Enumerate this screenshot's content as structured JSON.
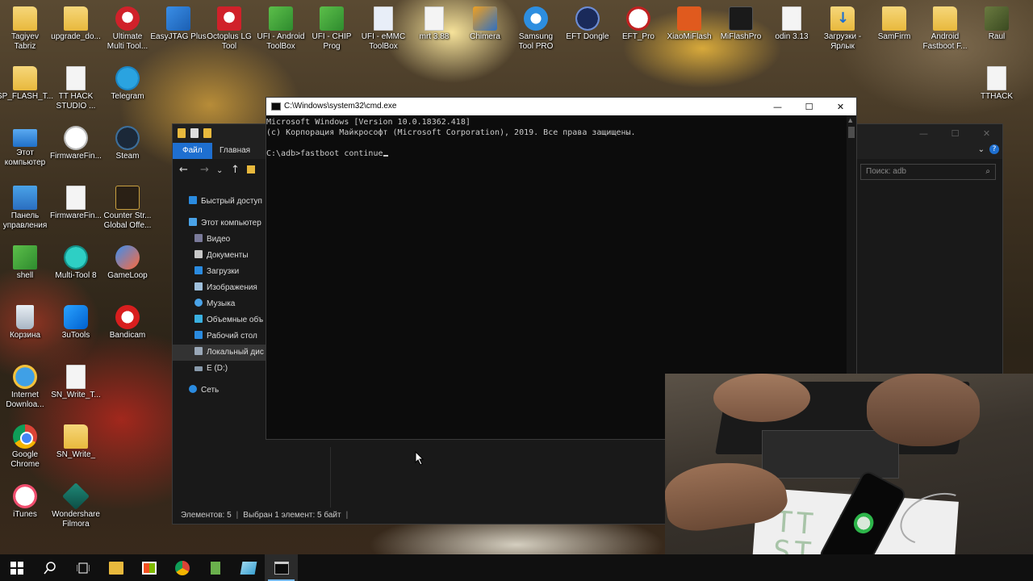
{
  "desktop": {
    "icons": [
      {
        "name": "Tagiyev Tabriz",
        "label": "Tagiyev\nTabriz"
      },
      {
        "name": "upgrade_do",
        "label": "upgrade_do..."
      },
      {
        "name": "Ultimate Multi Tool",
        "label": "Ultimate\nMulti Tool..."
      },
      {
        "name": "EasyJTAG Plus",
        "label": "EasyJTAG Plus"
      },
      {
        "name": "Octoplus LG Tool",
        "label": "Octoplus LG\nTool"
      },
      {
        "name": "UFI - Android ToolBox",
        "label": "UFI - Android\nToolBox"
      },
      {
        "name": "UFI - CHIP Prog",
        "label": "UFI - CHIP\nProg"
      },
      {
        "name": "UFI - eMMC ToolBox",
        "label": "UFI - eMMC\nToolBox"
      },
      {
        "name": "mrt 3.88",
        "label": "mrt 3.88"
      },
      {
        "name": "Chimera",
        "label": "Chimera"
      },
      {
        "name": "Samsung Tool PRO",
        "label": "Samsung\nTool PRO"
      },
      {
        "name": "EFT Dongle",
        "label": "EFT Dongle"
      },
      {
        "name": "EFT_Pro",
        "label": "EFT_Pro"
      },
      {
        "name": "XiaoMiFlash",
        "label": "XiaoMiFlash"
      },
      {
        "name": "MiFlashPro",
        "label": "MiFlashPro"
      },
      {
        "name": "odin 3.13",
        "label": "odin 3.13"
      },
      {
        "name": "Загрузки - Ярлык",
        "label": "Загрузки -\nЯрлык"
      },
      {
        "name": "SamFirm",
        "label": "SamFirm"
      },
      {
        "name": "Android Fastboot F",
        "label": "Android\nFastboot F..."
      },
      {
        "name": "Raul",
        "label": "Raul"
      },
      {
        "name": "SP_FLASH_T",
        "label": "SP_FLASH_T..."
      },
      {
        "name": "TT HACK STUDIO",
        "label": "TT HACK\nSTUDIO ..."
      },
      {
        "name": "Telegram",
        "label": "Telegram"
      },
      {
        "name": "TTHACK",
        "label": "TTHACK"
      },
      {
        "name": "Этот компьютер",
        "label": "Этот\nкомпьютер"
      },
      {
        "name": "FirmwareFin",
        "label": "FirmwareFin..."
      },
      {
        "name": "Steam",
        "label": "Steam"
      },
      {
        "name": "Панель управления",
        "label": "Панель\nуправления"
      },
      {
        "name": "FirmwareFin2",
        "label": "FirmwareFin..."
      },
      {
        "name": "Counter Strike Global Offe",
        "label": "Counter Str...\nGlobal Offe..."
      },
      {
        "name": "shell",
        "label": "shell"
      },
      {
        "name": "Multi-Tool 8",
        "label": "Multi-Tool 8"
      },
      {
        "name": "GameLoop",
        "label": "GameLoop"
      },
      {
        "name": "Корзина",
        "label": "Корзина"
      },
      {
        "name": "3uTools",
        "label": "3uTools"
      },
      {
        "name": "Bandicam",
        "label": "Bandicam"
      },
      {
        "name": "Internet Download",
        "label": "Internet\nDownloa..."
      },
      {
        "name": "SN_Write_T",
        "label": "SN_Write_T..."
      },
      {
        "name": "Google Chrome",
        "label": "Google\nChrome"
      },
      {
        "name": "SN_Write_",
        "label": "SN_Write_"
      },
      {
        "name": "iTunes",
        "label": "iTunes"
      },
      {
        "name": "Wondershare Filmora",
        "label": "Wondershare\nFilmora"
      }
    ]
  },
  "cmd": {
    "title": "C:\\Windows\\system32\\cmd.exe",
    "lines": [
      "Microsoft Windows [Version 10.0.18362.418]",
      "(c) Корпорация Майкрософт (Microsoft Corporation), 2019. Все права защищены.",
      "",
      "C:\\adb>fastboot continue"
    ],
    "controls": {
      "minimize": "—",
      "maximize": "☐",
      "close": "✕"
    }
  },
  "explorer": {
    "ribbon_tabs": [
      "Файл",
      "Главная"
    ],
    "search_placeholder": "Поиск: adb",
    "nav": [
      {
        "label": "Быстрый доступ"
      },
      {
        "label": "Этот компьютер"
      },
      {
        "label": "Видео"
      },
      {
        "label": "Документы"
      },
      {
        "label": "Загрузки"
      },
      {
        "label": "Изображения"
      },
      {
        "label": "Музыка"
      },
      {
        "label": "Объемные объ"
      },
      {
        "label": "Рабочий стол"
      },
      {
        "label": "Локальный дис"
      },
      {
        "label": "E (D:)"
      },
      {
        "label": "Сеть"
      }
    ],
    "status_items": "Элементов: 5",
    "status_selected": "Выбран 1 элемент: 5 байт"
  },
  "webcam": {
    "watermark": "TT H\nST"
  },
  "taskbar": {
    "buttons": [
      "start",
      "search",
      "task-view",
      "file-explorer",
      "store",
      "chrome",
      "app-green",
      "app-notepad",
      "cmd"
    ]
  },
  "colors": {
    "cmd_bg": "#0c0c0c",
    "cmd_text": "#cccccc",
    "explorer_bg": "#191919",
    "accent": "#1e6fd0",
    "taskbar": "#101010"
  }
}
